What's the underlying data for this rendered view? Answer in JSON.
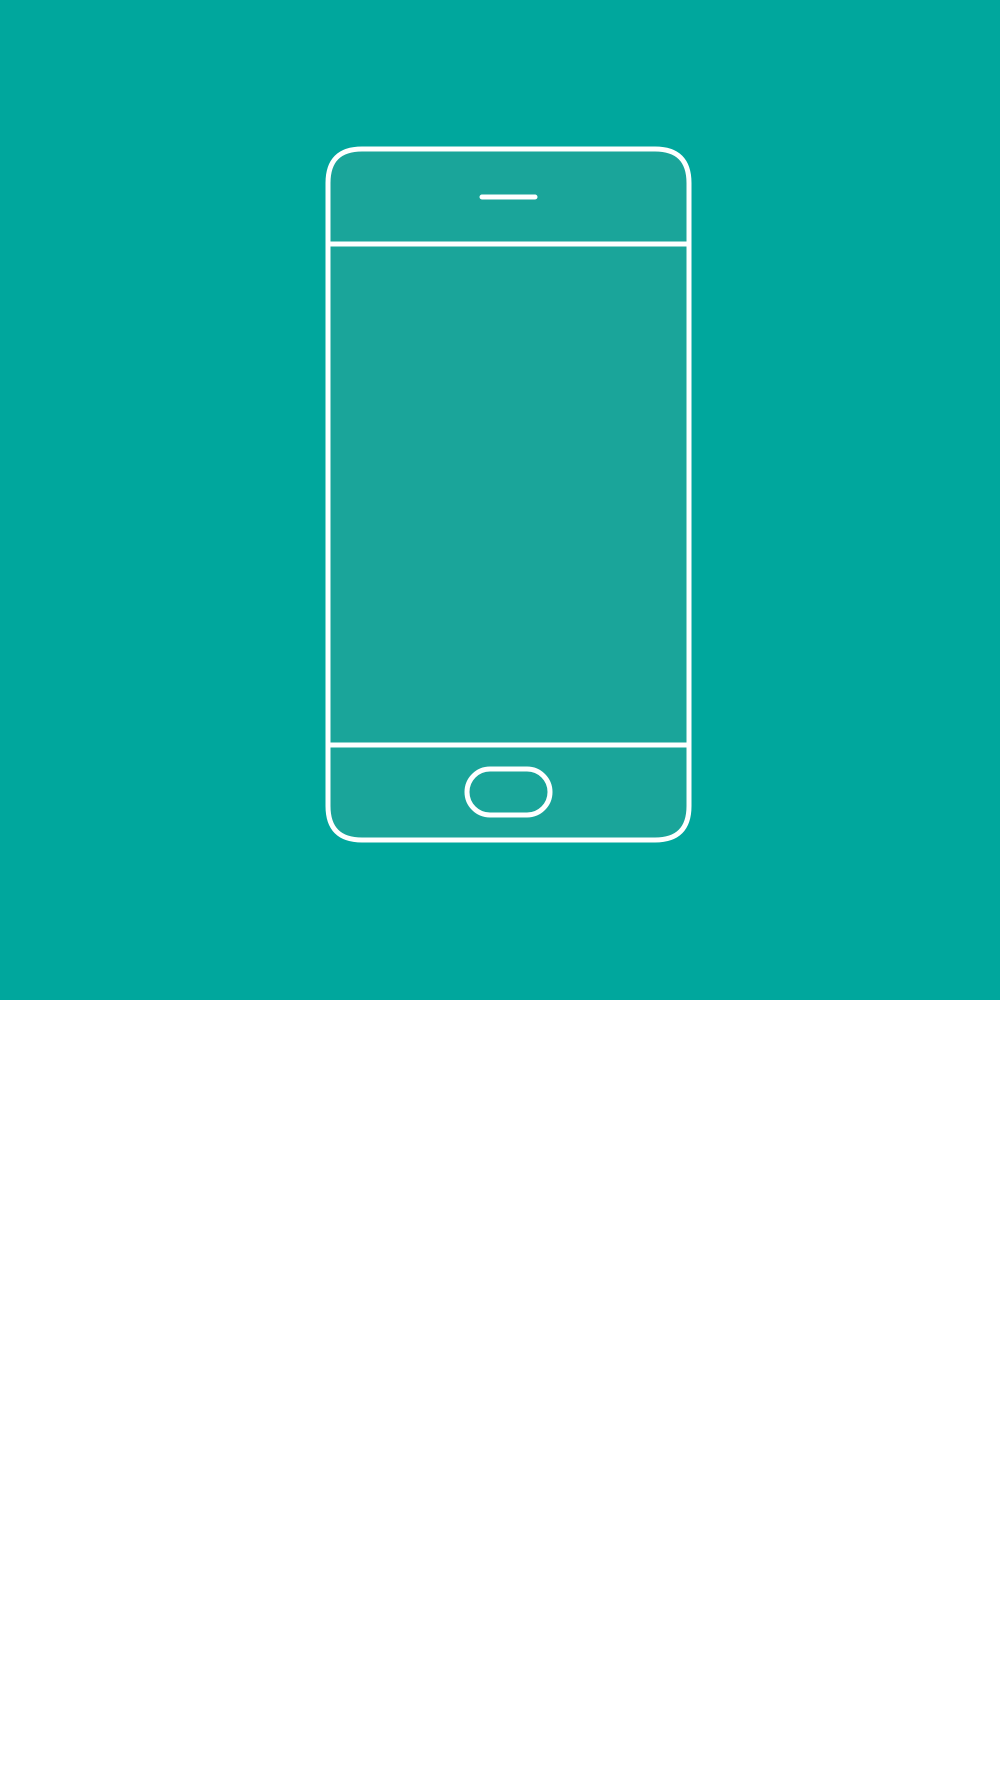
{
  "hero": {
    "background_color": "#00a79d",
    "illustration": "smartphone-outline-icon",
    "phone_fill_color": "#1aa59a",
    "outline_color": "#ffffff"
  },
  "lower_panel": {
    "background_color": "#ffffff"
  }
}
